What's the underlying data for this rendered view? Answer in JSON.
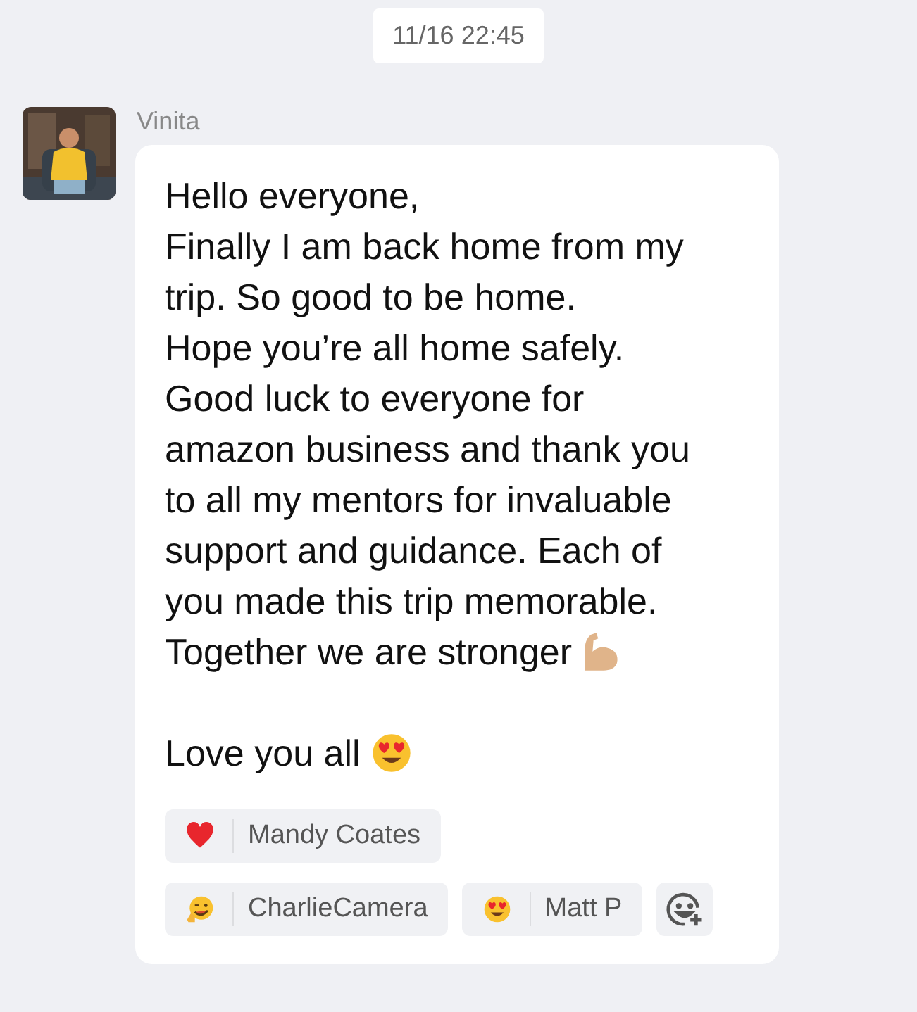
{
  "timestamp": "11/16 22:45",
  "message": {
    "sender": "Vinita",
    "avatar": {
      "kind": "picture"
    },
    "paragraphs": [
      {
        "lines": [
          {
            "text": "Hello everyone,"
          },
          {
            "text": "Finally I am back home from my"
          },
          {
            "text": "trip. So good to be home."
          },
          {
            "text": "Hope you’re all home safely."
          },
          {
            "text": "Good luck to everyone for"
          },
          {
            "text": "amazon business and thank you"
          },
          {
            "text": "to all my mentors for invaluable"
          },
          {
            "text": "support and guidance. Each of"
          },
          {
            "text": "you made this trip memorable."
          },
          {
            "text": "Together we are stronger",
            "kind": "biceps"
          }
        ]
      },
      {
        "lines": [
          {
            "text": "Love you all ",
            "kind": "heart-eyes"
          }
        ]
      }
    ],
    "reactions": [
      [
        {
          "kind": "heart",
          "name": "Mandy Coates"
        }
      ],
      [
        {
          "kind": "wink",
          "name": "CharlieCamera"
        },
        {
          "kind": "heart-eyes",
          "name": "Matt P"
        }
      ]
    ]
  }
}
